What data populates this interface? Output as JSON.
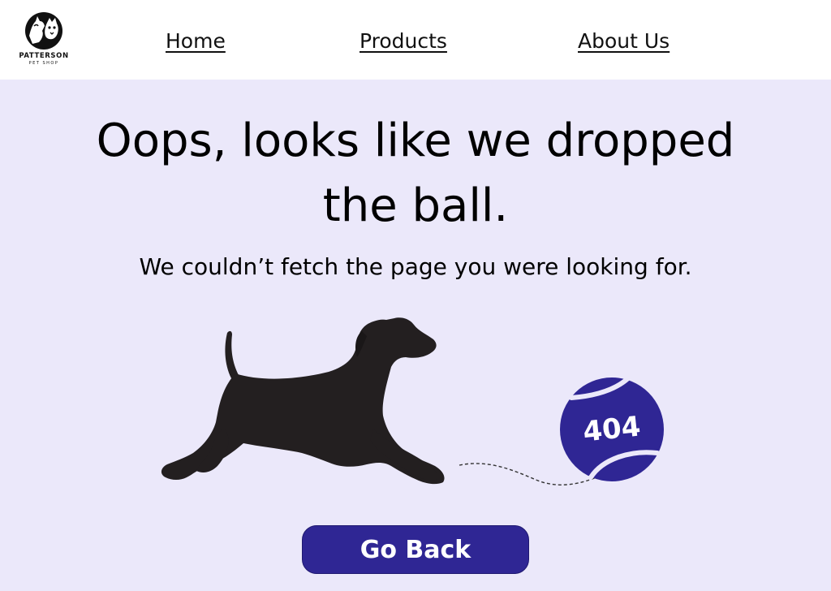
{
  "brand": {
    "name": "PATTERSON",
    "tagline": "PET SHOP"
  },
  "nav": {
    "items": [
      {
        "label": "Home"
      },
      {
        "label": "Products"
      },
      {
        "label": "About Us"
      }
    ]
  },
  "main": {
    "headline_line1": "Oops, looks like we dropped",
    "headline_line2": "the ball.",
    "subheadline": "We couldn’t fetch the page you were looking for.",
    "ball_label": "404",
    "button_label": "Go Back"
  },
  "colors": {
    "page_background": "#ebe8fa",
    "header_background": "#ffffff",
    "accent": "#2f2694",
    "dog": "#231f20"
  },
  "icons": {
    "logo": "dog-and-cat-icon",
    "dog": "running-dog-icon",
    "ball": "tennis-ball-icon"
  }
}
